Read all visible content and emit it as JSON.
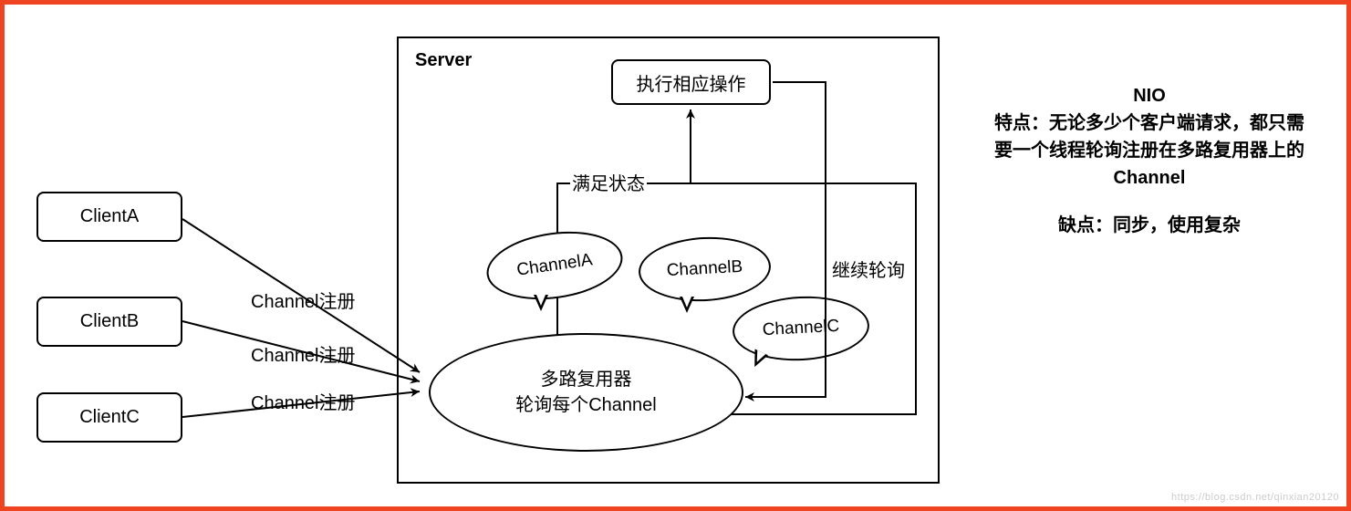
{
  "clients": {
    "a": "ClientA",
    "b": "ClientB",
    "c": "ClientC"
  },
  "register_label": "Channel注册",
  "server": {
    "label": "Server",
    "action_box": "执行相应操作",
    "inner_label": "满足状态",
    "continue_label": "继续轮询",
    "multiplexer_line1": "多路复用器",
    "multiplexer_line2": "轮询每个Channel",
    "channels": {
      "a": "ChannelA",
      "b": "ChannelB",
      "c": "ChannelC"
    }
  },
  "side": {
    "title": "NIO",
    "feature_prefix": "特点：",
    "feature_text": "无论多少个客户端请求，都只需要一个线程轮询注册在多路复用器上的Channel",
    "drawback_prefix": "缺点：",
    "drawback_text": "同步，使用复杂"
  },
  "watermark": "https://blog.csdn.net/qinxian20120"
}
